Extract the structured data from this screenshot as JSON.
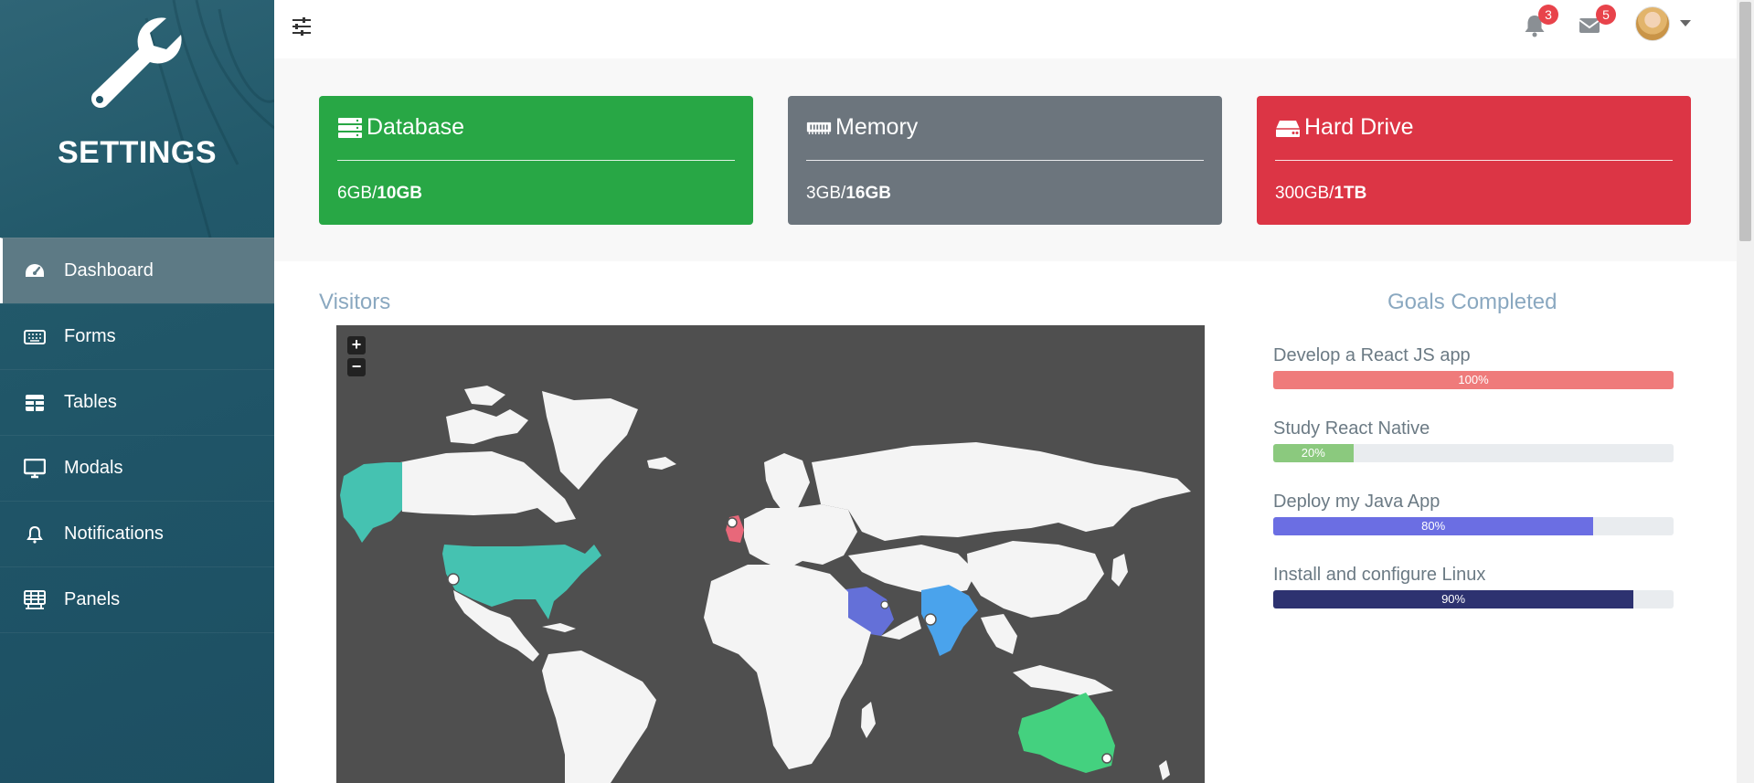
{
  "sidebar": {
    "title": "SETTINGS",
    "items": [
      {
        "label": "Dashboard",
        "icon": "speedometer-icon",
        "active": true
      },
      {
        "label": "Forms",
        "icon": "keyboard-icon",
        "active": false
      },
      {
        "label": "Tables",
        "icon": "table-icon",
        "active": false
      },
      {
        "label": "Modals",
        "icon": "monitor-icon",
        "active": false
      },
      {
        "label": "Notifications",
        "icon": "bell-icon",
        "active": false
      },
      {
        "label": "Panels",
        "icon": "grid-panel-icon",
        "active": false
      }
    ]
  },
  "topbar": {
    "menu_icon": "sliders-icon",
    "notifications_count": "3",
    "messages_count": "5",
    "avatar": "user-avatar"
  },
  "stats": [
    {
      "title": "Database",
      "used": "6GB/",
      "total": "10GB",
      "color": "#28a745",
      "icon": "server-icon"
    },
    {
      "title": "Memory",
      "used": "3GB/",
      "total": "16GB",
      "color": "#6c757d",
      "icon": "memory-icon"
    },
    {
      "title": "Hard Drive",
      "used": "300GB/",
      "total": "1TB",
      "color": "#dc3545",
      "icon": "hard-drive-icon"
    }
  ],
  "visitors": {
    "title": "Visitors",
    "zoom_in": "+",
    "zoom_out": "−"
  },
  "goals": {
    "title": "Goals Completed",
    "items": [
      {
        "label": "Develop a React JS app",
        "percent": 100,
        "text": "100%",
        "color": "#ef7b7b"
      },
      {
        "label": "Study React Native",
        "percent": 20,
        "text": "20%",
        "color": "#8bc97e"
      },
      {
        "label": "Deploy my Java App",
        "percent": 80,
        "text": "80%",
        "color": "#6b6ee3"
      },
      {
        "label": "Install and configure Linux",
        "percent": 90,
        "text": "90%",
        "color": "#2d3270"
      }
    ]
  }
}
